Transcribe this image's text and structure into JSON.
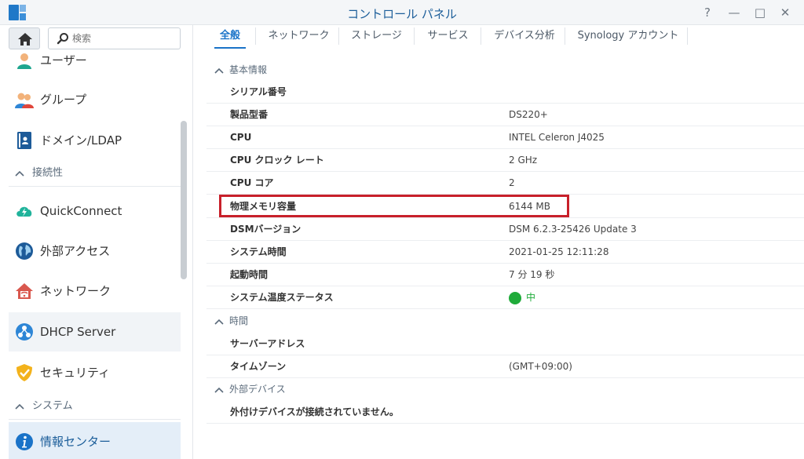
{
  "window": {
    "title": "コントロール パネル",
    "controls": {
      "help": "?",
      "minimize": "—",
      "maximize": "□",
      "close": "✕"
    }
  },
  "sidebar": {
    "search_placeholder": "検索",
    "items": {
      "user": "ユーザー",
      "group": "グループ",
      "domain": "ドメイン/LDAP",
      "connectivity": "接続性",
      "quickconnect": "QuickConnect",
      "external_access": "外部アクセス",
      "network": "ネットワーク",
      "dhcp": "DHCP Server",
      "security": "セキュリティ",
      "system": "システム",
      "info_center": "情報センター"
    }
  },
  "tabs": [
    "全般",
    "ネットワーク",
    "ストレージ",
    "サービス",
    "デバイス分析",
    "Synology アカウント"
  ],
  "content": {
    "basic_info": {
      "title": "基本情報",
      "rows": [
        {
          "label": "シリアル番号",
          "value": ""
        },
        {
          "label": "製品型番",
          "value": "DS220+"
        },
        {
          "label": "CPU",
          "value": "INTEL Celeron J4025"
        },
        {
          "label": "CPU クロック レート",
          "value": "2 GHz"
        },
        {
          "label": "CPU コア",
          "value": "2"
        },
        {
          "label": "物理メモリ容量",
          "value": "6144 MB"
        },
        {
          "label": "DSMバージョン",
          "value": "DSM 6.2.3-25426 Update 3"
        },
        {
          "label": "システム時間",
          "value": "2021-01-25 12:11:28"
        },
        {
          "label": "起動時間",
          "value": "7 分 19 秒"
        },
        {
          "label": "システム温度ステータス",
          "value": "中"
        }
      ]
    },
    "time": {
      "title": "時間",
      "rows": [
        {
          "label": "サーバーアドレス",
          "value": ""
        },
        {
          "label": "タイムゾーン",
          "value": "(GMT+09:00)"
        }
      ]
    },
    "external_devices": {
      "title": "外部デバイス",
      "message": "外付けデバイスが接続されていません。"
    }
  },
  "colors": {
    "accent": "#1a73c8",
    "title": "#1c5e9a",
    "status_good": "#1fab3a",
    "highlight": "#c8202a"
  }
}
